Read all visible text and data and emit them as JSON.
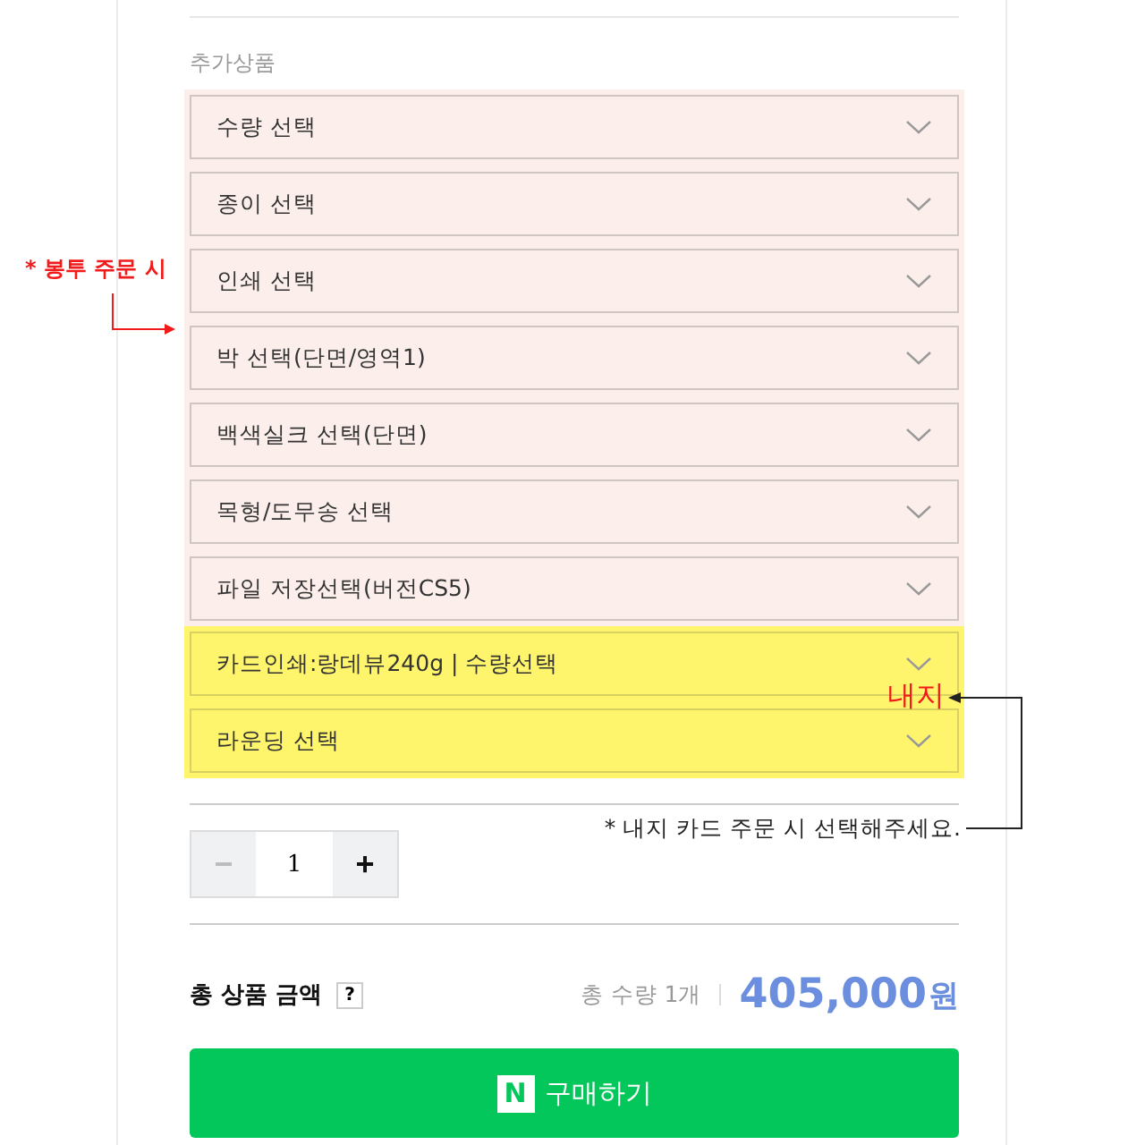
{
  "section_title": "추가상품",
  "option_groups": [
    {
      "kind": "envelope",
      "items": [
        "수량 선택",
        "종이 선택",
        "인쇄 선택",
        "박 선택(단면/영역1)",
        "백색실크 선택(단면)",
        "목형/도무송 선택",
        "파일 저장선택(버전CS5)"
      ]
    },
    {
      "kind": "inner",
      "items": [
        "카드인쇄:랑데뷰240g | 수량선택",
        "라운딩 선택"
      ]
    }
  ],
  "annotations": {
    "envelope_note": "* 봉투 주문 시",
    "inner_label": "내지",
    "inner_note": "* 내지 카드 주문 시 선택해주세요."
  },
  "quantity": {
    "minus": "−",
    "value": "1",
    "plus": "+"
  },
  "total": {
    "label": "총 상품 금액",
    "help": "?",
    "count": "총 수량 1개",
    "price": "405,000",
    "unit": "원"
  },
  "buy_button": {
    "logo": "N",
    "label": "구매하기"
  }
}
